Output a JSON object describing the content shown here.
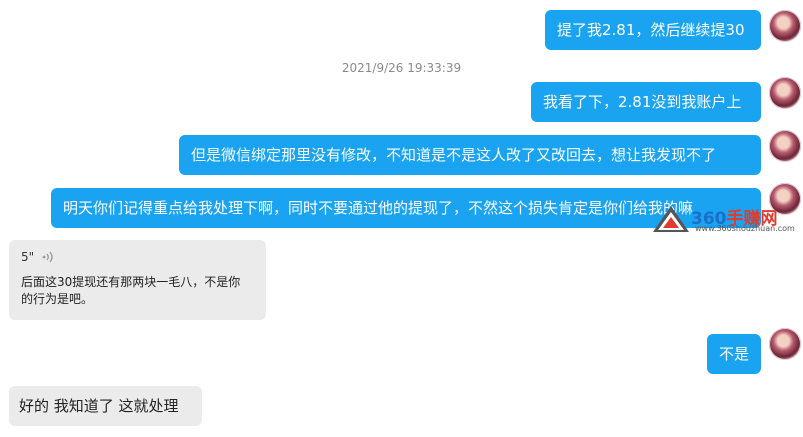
{
  "messages": [
    {
      "text": "提了我2.81，然后继续提30"
    },
    {
      "text": "我看了下，2.81没到我账户上"
    },
    {
      "text": "但是微信绑定那里没有修改，不知道是不是这人改了又改回去，想让我发现不了"
    },
    {
      "text": "明天你们记得重点给我处理下啊，同时不要通过他的提现了，不然这个损失肯定是你们给我的嘛"
    },
    {
      "text": "不是"
    }
  ],
  "timestamp": "2021/9/26 19:33:39",
  "incoming": {
    "voice_duration": "5\"",
    "voice_transcript": "后面这30提现还有那两块一毛八，不是你的行为是吧。",
    "reply": "好的 我知道了 这就处理"
  },
  "watermark": {
    "brand_num": "360",
    "brand_cn": "手赚网",
    "url": "www.360shouzhuan.com"
  },
  "colors": {
    "outgoing_bubble": "#1aa3f0",
    "incoming_bubble": "#ebebeb"
  }
}
